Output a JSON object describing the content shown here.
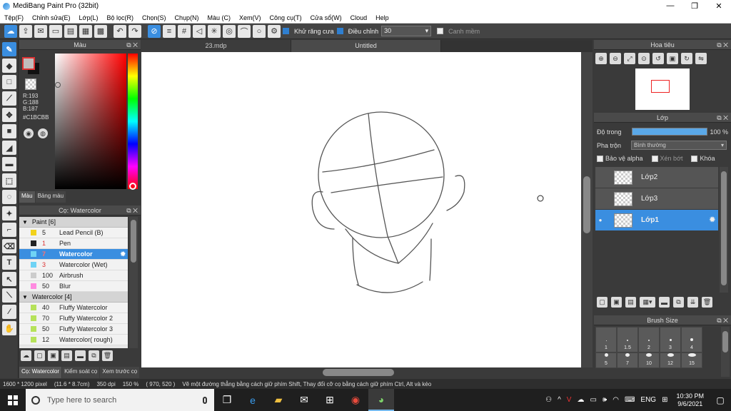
{
  "app": {
    "title": "MediBang Paint Pro (32bit)",
    "window_buttons": [
      "—",
      "❐",
      "✕"
    ]
  },
  "menu": [
    "Tệp(F)",
    "Chỉnh sửa(E)",
    "Lớp(L)",
    "Bộ lọc(R)",
    "Chọn(S)",
    "Chụp(N)",
    "Màu (C)",
    "Xem(V)",
    "Công cụ(T)",
    "Cửa sổ(W)",
    "Cloud",
    "Help"
  ],
  "toolbar": {
    "antialias_label": "Khử răng cưa",
    "adjust_label": "Điều chỉnh",
    "adjust_value": "30",
    "snap_label": "Canh mềm"
  },
  "color_panel": {
    "title": "Màu",
    "r": "R:193",
    "g": "G:188",
    "b": "B:187",
    "hex": "#C1BCBB",
    "tabs": [
      "Màu",
      "Bảng màu"
    ],
    "fg_color": "#c1bcbb"
  },
  "brush_panel": {
    "title": "Cọ: Watercolor",
    "groups": [
      {
        "name": "Paint [6]",
        "items": [
          {
            "size": "5",
            "name": "Lead Pencil (B)",
            "color": "#f2d21c"
          },
          {
            "size": "1",
            "name": "Pen",
            "color": "#222222"
          },
          {
            "size": "7",
            "name": "Watercolor",
            "color": "#6fd3f5",
            "active": true
          },
          {
            "size": "3",
            "name": "Watercolor (Wet)",
            "color": "#6fd3f5"
          },
          {
            "size": "100",
            "name": "Airbrush",
            "color": "#cccccc"
          },
          {
            "size": "50",
            "name": "Blur",
            "color": "#ff8be0"
          }
        ]
      },
      {
        "name": "Watercolor [4]",
        "items": [
          {
            "size": "40",
            "name": "Fluffy Watercolor",
            "color": "#b6e25a"
          },
          {
            "size": "70",
            "name": "Fluffy Watercolor 2",
            "color": "#b6e25a"
          },
          {
            "size": "50",
            "name": "Fluffy Watercolor 3",
            "color": "#b6e25a"
          },
          {
            "size": "12",
            "name": "Watercolor( rough)",
            "color": "#b6e25a"
          }
        ]
      }
    ],
    "tabs": [
      "Cọ: Watercolor",
      "Kiểm soát cọ",
      "Xem trước cọ"
    ]
  },
  "documents": {
    "tabs": [
      "23.mdp",
      "Untitled"
    ]
  },
  "navigator": {
    "title": "Hoa tiêu"
  },
  "layer_panel": {
    "title": "Lớp",
    "opacity_label": "Độ trong",
    "opacity_value": "100 %",
    "blend_label": "Pha trộn",
    "blend_value": "Bình thường",
    "protect_alpha": "Bảo vệ alpha",
    "clip": "Xén bớt",
    "lock": "Khóa",
    "layers": [
      {
        "name": "Lớp2",
        "active": false
      },
      {
        "name": "Lớp3",
        "active": false
      },
      {
        "name": "Lớp1",
        "active": true
      }
    ]
  },
  "brush_size": {
    "title": "Brush Size",
    "sizes": [
      "1",
      "1.5",
      "2",
      "3",
      "4",
      "5",
      "7",
      "10",
      "12",
      "15"
    ]
  },
  "status": {
    "dimensions": "1600 * 1200 pixel",
    "size_cm": "(11.6 * 8.7cm)",
    "dpi": "350 dpi",
    "zoom": "150 %",
    "coords": "( 970, 520 )",
    "hint": "Vẽ một đường thẳng bằng cách giữ phím Shift, Thay đổi cỡ cọ bằng cách giữ phím Ctrl, Alt và kéo"
  },
  "taskbar": {
    "search_placeholder": "Type here to search",
    "language": "ENG",
    "time": "10:30 PM",
    "date": "9/6/2021"
  }
}
